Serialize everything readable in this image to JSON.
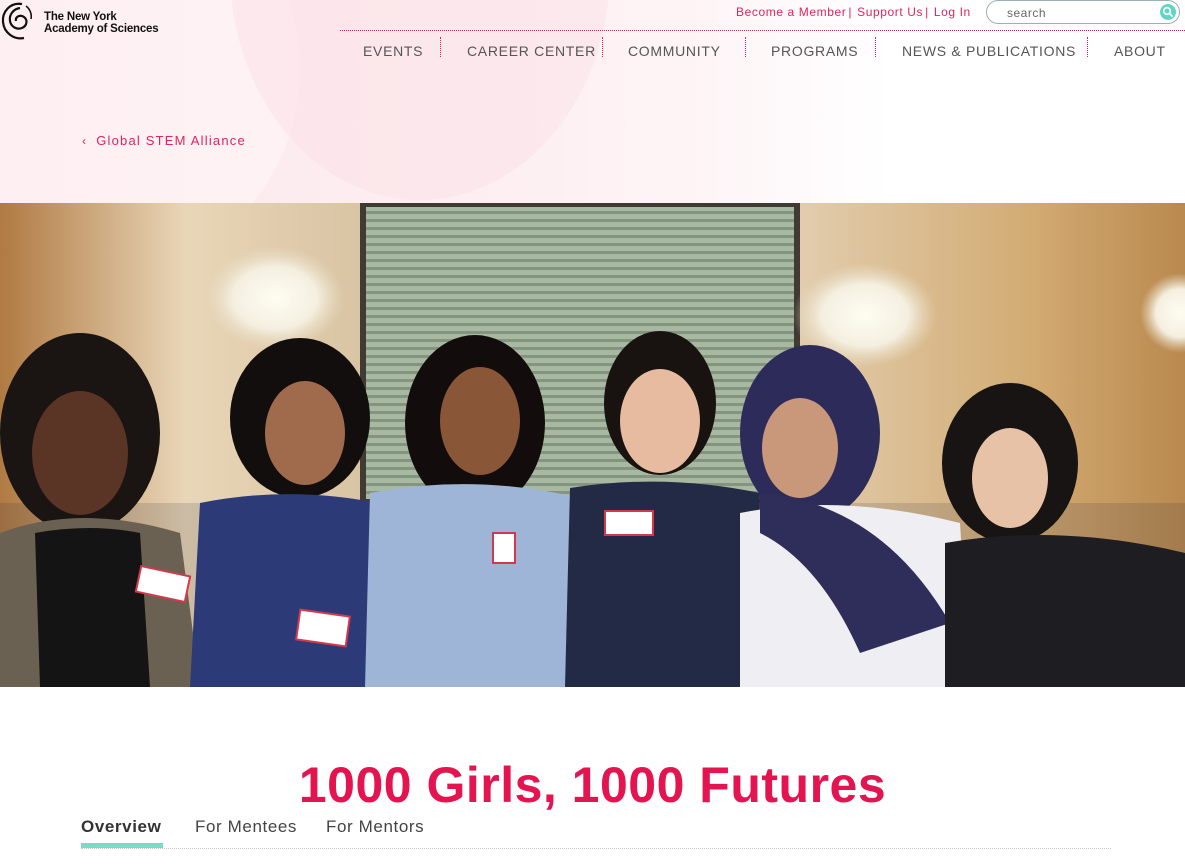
{
  "brand": {
    "line1": "The New York",
    "line2": "Academy of Sciences"
  },
  "utility": {
    "become_member": "Become a Member",
    "support_us": "Support Us",
    "log_in": "Log In",
    "separator": "|",
    "search_placeholder": "search"
  },
  "nav": {
    "items": [
      {
        "label": "EVENTS"
      },
      {
        "label": "CAREER CENTER"
      },
      {
        "label": "COMMUNITY"
      },
      {
        "label": "PROGRAMS"
      },
      {
        "label": "NEWS & PUBLICATIONS"
      },
      {
        "label": "ABOUT"
      }
    ]
  },
  "breadcrumb": {
    "chevron": "‹",
    "label": "Global STEM Alliance"
  },
  "page_title": "1000 Girls, 1000 Futures",
  "tabs": [
    {
      "label": "Overview",
      "active": true
    },
    {
      "label": "For Mentees",
      "active": false
    },
    {
      "label": "For Mentors",
      "active": false
    }
  ],
  "colors": {
    "accent": "#e3144f",
    "link": "#e0245e",
    "tab_indicator": "#76dcc8",
    "search_button": "#63d6c3"
  },
  "icons": {
    "logo": "academy-logo-icon",
    "search": "search-icon",
    "back": "chevron-left-icon"
  }
}
